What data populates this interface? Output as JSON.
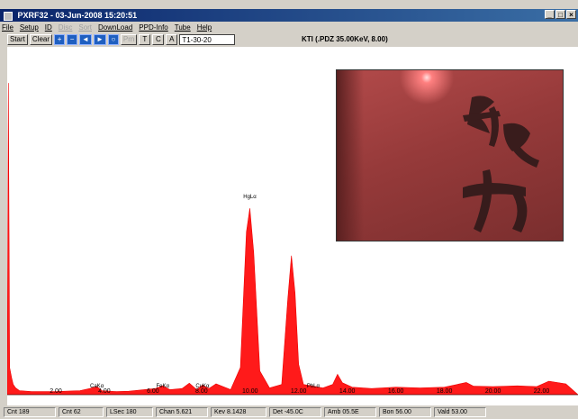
{
  "window": {
    "title": "PXRF32 - 03-Jun-2008 15:20:51",
    "buttons": [
      "_",
      "□",
      "×"
    ]
  },
  "menu": {
    "items": [
      {
        "label": "File",
        "enabled": true
      },
      {
        "label": "Setup",
        "enabled": true
      },
      {
        "label": "ID",
        "enabled": true
      },
      {
        "label": "Disc",
        "enabled": false
      },
      {
        "label": "Sort",
        "enabled": false
      },
      {
        "label": "DownLoad",
        "enabled": true
      },
      {
        "label": "PPD-Info",
        "enabled": true
      },
      {
        "label": "Tube",
        "enabled": true
      },
      {
        "label": "Help",
        "enabled": true
      }
    ]
  },
  "toolbar": {
    "start_label": "Start",
    "clear_label": "Clear",
    "disabled_label": "Prn",
    "t_label": "T",
    "c_label": "C",
    "a_label": "A",
    "sample_value": "T1-30-20"
  },
  "plot": {
    "ktitle": "KTI (.PDZ 35.00KeV, 8.00)",
    "peak_labels": [
      {
        "text": "HgLα",
        "energy": 9.99
      },
      {
        "text": "CaKα",
        "energy": 3.69
      },
      {
        "text": "FeKα",
        "energy": 6.4
      },
      {
        "text": "CuKα",
        "energy": 8.04
      },
      {
        "text": "PbLα",
        "energy": 12.6
      }
    ]
  },
  "chart_data": {
    "type": "line",
    "title": "KTI (.PDZ 35.00KeV, 8.00)",
    "xlabel": "",
    "ylabel": "",
    "xlim": [
      0,
      23.5
    ],
    "ylim": [
      0,
      100
    ],
    "ticks": [
      "2.00",
      "4.00",
      "6.00",
      "8.00",
      "10.00",
      "12.00",
      "14.00",
      "16.00",
      "18.00",
      "20.00",
      "22.00"
    ],
    "tick_values": [
      2,
      4,
      6,
      8,
      10,
      12,
      14,
      16,
      18,
      20,
      22
    ],
    "series": [
      {
        "x": [
          0,
          0.05,
          0.1,
          0.18,
          0.25,
          0.35,
          0.5,
          1,
          2,
          3,
          3.4,
          3.69,
          3.9,
          4.5,
          5,
          6.1,
          6.4,
          6.7,
          7.2,
          7.5,
          7.8,
          8.04,
          8.3,
          8.6,
          9.2,
          9.6,
          9.85,
          9.99,
          10.15,
          10.4,
          10.8,
          11.3,
          11.55,
          11.7,
          11.85,
          12.0,
          12.2,
          12.6,
          13.0,
          13.4,
          13.6,
          13.8,
          14.2,
          15,
          16,
          17,
          18,
          18.9,
          19.2,
          20,
          21,
          21.8,
          22.3,
          23,
          23.5
        ],
        "y": [
          0,
          92,
          8,
          5,
          3,
          2,
          1.2,
          0.9,
          0.9,
          1.2,
          1.8,
          2.4,
          1.2,
          0.9,
          1,
          1.8,
          2.6,
          1.5,
          1.8,
          3.4,
          1.5,
          2.8,
          1.8,
          3.2,
          1.5,
          8,
          48,
          55,
          42,
          7,
          2,
          3,
          28,
          41,
          30,
          9,
          3,
          2.5,
          2,
          3,
          6,
          3.5,
          2.2,
          1.8,
          2.2,
          2,
          2.2,
          3.6,
          2.5,
          2.4,
          2.6,
          2.4,
          4,
          3.2,
          0
        ]
      }
    ]
  },
  "photo": {
    "alt": "photo-inset"
  },
  "status": {
    "cells": [
      "Cnt 189",
      "Cnt 62",
      "LSec 180",
      "Chan 5.621",
      "Kev 8.1428",
      "Det -45.0C",
      "Amb 05.5E",
      "Bon 56.00",
      "Vald 53.00"
    ]
  }
}
